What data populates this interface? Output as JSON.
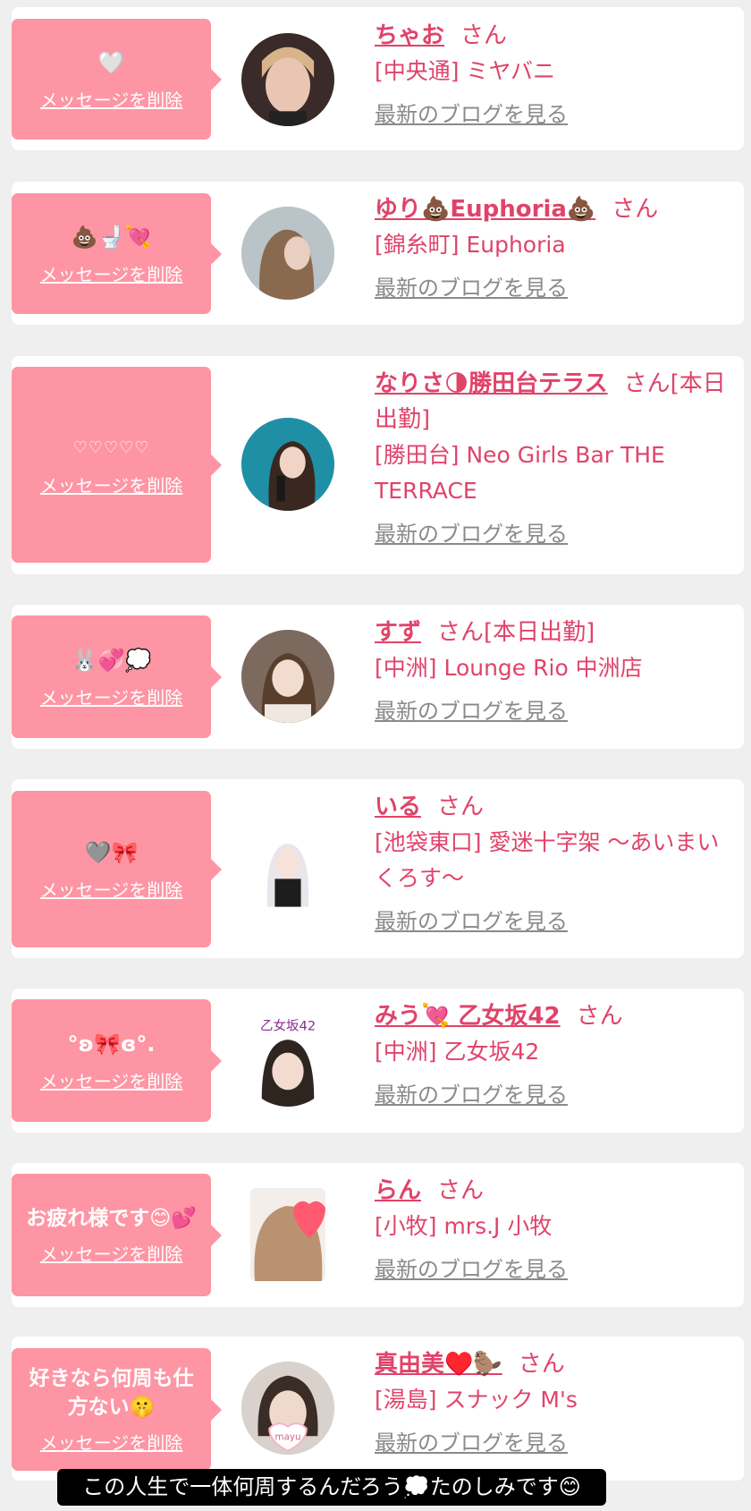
{
  "delete_label": "メッセージを削除",
  "blog_label": "最新のブログを見る",
  "honorific": "さん",
  "colors": {
    "accent": "#e0436a",
    "bubble": "#fe95a4",
    "muted": "#8a8a8a",
    "background": "#efefef"
  },
  "cards": [
    {
      "message": "🤍",
      "name": "ちゃお",
      "status": "",
      "shop": "[中央通] ミヤバニ",
      "avatar": "avatar-photo"
    },
    {
      "message": "💩🚽💘",
      "name": "ゆり💩Euphoria💩",
      "status": "",
      "shop": "[錦糸町] Euphoria",
      "avatar": "avatar-photo"
    },
    {
      "message": "♡♡♡♡♡",
      "name": "なりさ🌗勝田台テラス",
      "status": "[本日出勤]",
      "shop": "[勝田台] Neo Girls Bar THE TERRACE",
      "avatar": "avatar-photo"
    },
    {
      "message": "🐰💞💭",
      "name": "すず",
      "status": "[本日出勤]",
      "shop": "[中洲] Lounge Rio 中洲店",
      "avatar": "avatar-photo"
    },
    {
      "message": "🩶🎀",
      "name": "いる",
      "status": "",
      "shop": "[池袋東口] 愛迷十字架 〜あいまいくろす〜",
      "avatar": "avatar-photo"
    },
    {
      "message": "°ʚ🎀ɞ°.",
      "name": "みう💘 乙女坂42",
      "status": "",
      "shop": "[中洲] 乙女坂42",
      "avatar": "avatar-photo",
      "avatar_text": "乙女坂42"
    },
    {
      "message": "お疲れ様です😊💕",
      "name": "らん",
      "status": "",
      "shop": "[小牧] mrs.J 小牧",
      "avatar": "avatar-photo"
    },
    {
      "message": "好きなら何周も仕方ない🤫",
      "name": "真由美♥️🦫",
      "status": "",
      "shop": "[湯島] スナック M's",
      "avatar": "avatar-photo",
      "avatar_text": "mayu"
    }
  ],
  "caption": "この人生で一体何周するんだろう💭たのしみです😊"
}
